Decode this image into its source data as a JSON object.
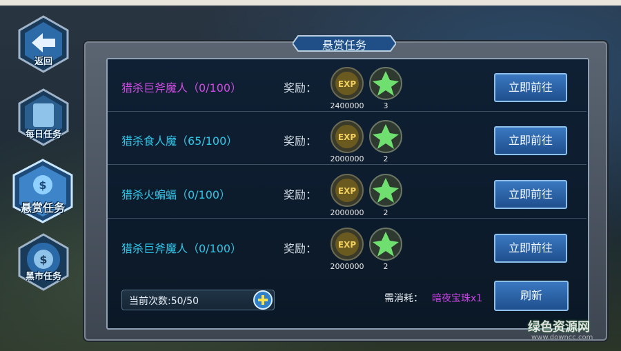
{
  "nav": {
    "back": "返回",
    "daily": "每日任务",
    "bounty": "悬赏任务",
    "blackmarket": "黑市任务"
  },
  "panel": {
    "title": "悬赏任务"
  },
  "rows": [
    {
      "name": "猎杀巨斧魔人（0/100）",
      "reward_label": "奖励：",
      "exp": "2400000",
      "gem": "3",
      "go": "立即前往"
    },
    {
      "name": "猎杀食人魔（65/100）",
      "reward_label": "奖励：",
      "exp": "2000000",
      "gem": "2",
      "go": "立即前往"
    },
    {
      "name": "猎杀火蝙蝠（0/100）",
      "reward_label": "奖励：",
      "exp": "2000000",
      "gem": "2",
      "go": "立即前往"
    },
    {
      "name": "猎杀巨斧魔人（0/100）",
      "reward_label": "奖励：",
      "exp": "2000000",
      "gem": "2",
      "go": "立即前往"
    }
  ],
  "footer": {
    "count_text": "当前次数:50/50",
    "cost_label": "需消耗：",
    "cost_item": "暗夜宝珠x1",
    "refresh": "刷新"
  },
  "exp_badge": "EXP",
  "watermark": {
    "line1": "绿色资源网",
    "line2": "www.downcc.com"
  },
  "colors": {
    "name_cyan": "#2fc7ea",
    "name_purple": "#d24ce6",
    "button_blue": "#2a66ab",
    "cost_purple": "#c844e6"
  }
}
